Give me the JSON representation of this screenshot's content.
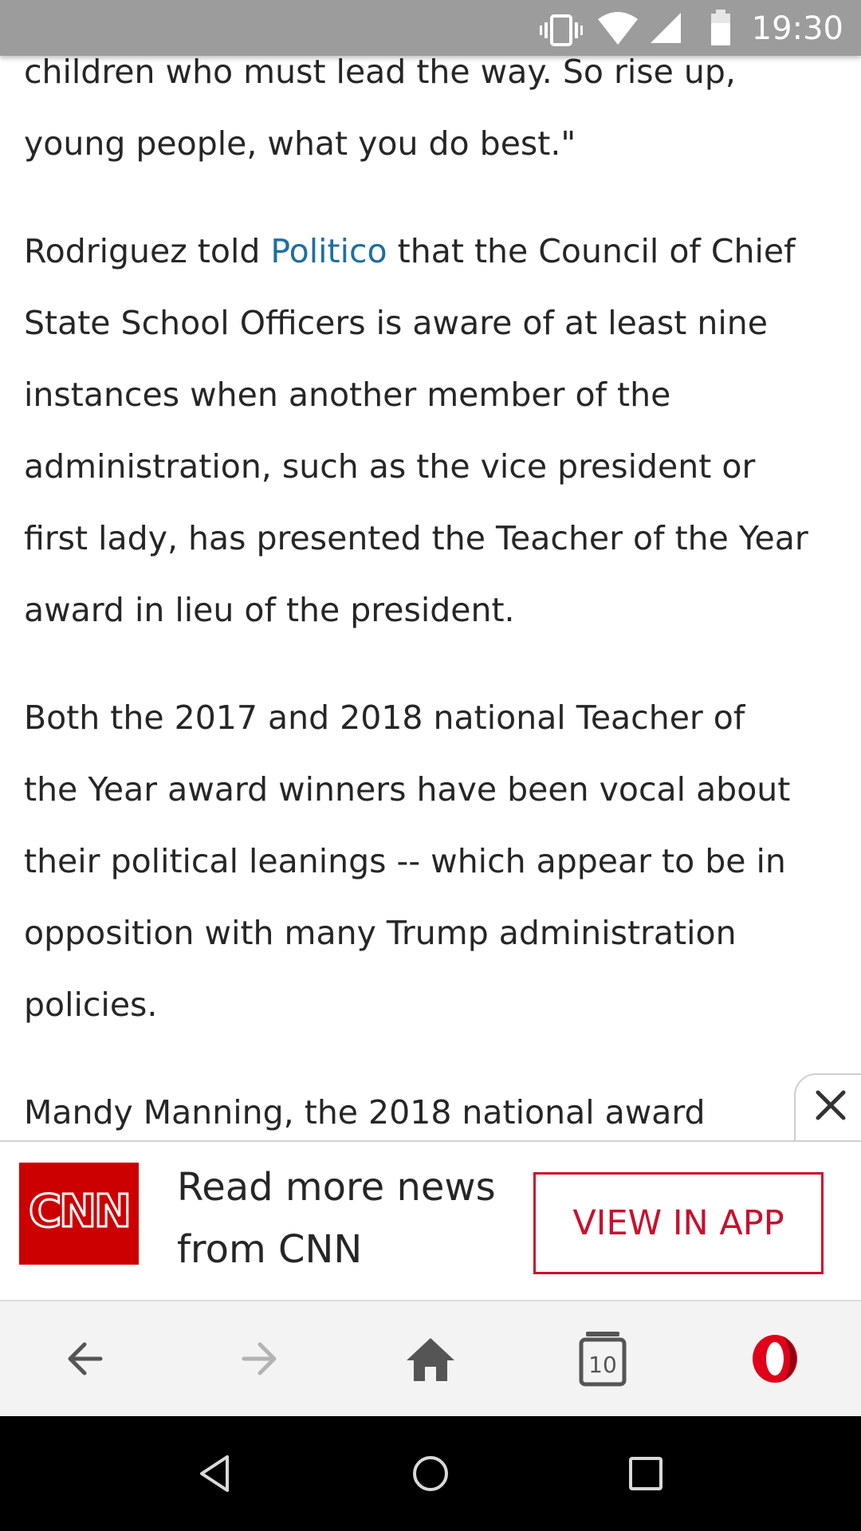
{
  "status_bar": {
    "time": "19:30",
    "icons": [
      "vibrate-icon",
      "wifi-icon",
      "cellular-signal-icon",
      "battery-icon"
    ]
  },
  "article": {
    "p1": {
      "line1": "children who must lead the way. So rise up,",
      "line2": "young people, what you do best.\""
    },
    "p2": {
      "line1_before": "Rodriguez told ",
      "line1_link": "Politico",
      "line1_after": " that the Council of Chief",
      "line2": "State School Officers is aware of at least nine",
      "line3": "instances when another member of the",
      "line4": "administration, such as the vice president or",
      "line5": "first lady, has presented the Teacher of the Year",
      "line6": "award in lieu of the president."
    },
    "p3": {
      "line1": "Both the 2017 and 2018 national Teacher of",
      "line2": "the Year award winners have been vocal about",
      "line3": "their political leanings -- which appear to be in",
      "line4": "opposition with many Trump administration",
      "line5": "policies."
    },
    "p4": {
      "line1": "Mandy Manning, the 2018 national award"
    },
    "link_color": "#1e6fa0",
    "text_color": "#262626"
  },
  "promo": {
    "logo_text": "CNN",
    "text_line1": "Read more news",
    "text_line2": "from CNN",
    "button_label": "VIEW IN APP",
    "close_icon": "close-icon",
    "brand_color": "#cc0000"
  },
  "browser_toolbar": {
    "tab_count": "10",
    "icons": [
      "back-arrow-icon",
      "forward-arrow-icon",
      "home-icon",
      "tabs-icon",
      "opera-logo-icon"
    ]
  },
  "nav_bar": {
    "icons": [
      "nav-back-icon",
      "nav-home-icon",
      "nav-recents-icon"
    ]
  }
}
